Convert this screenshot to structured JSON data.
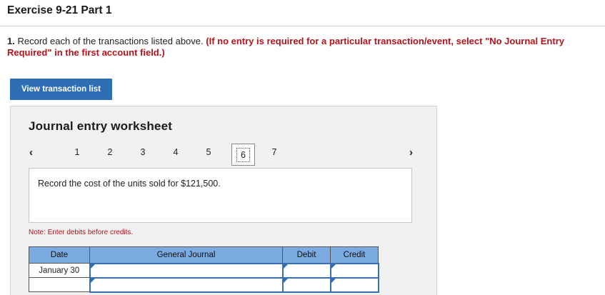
{
  "header": {
    "title": "Exercise 9-21 Part 1"
  },
  "instruction": {
    "number": "1.",
    "text": "Record each of the transactions listed above.",
    "note": "(If no entry is required for a particular transaction/event, select \"No Journal Entry Required\" in the first account field.)"
  },
  "buttons": {
    "view_transaction_list": "View transaction list"
  },
  "worksheet": {
    "title": "Journal entry worksheet",
    "pages": [
      "1",
      "2",
      "3",
      "4",
      "5",
      "6",
      "7"
    ],
    "current_page": "6",
    "prev_icon": "‹",
    "next_icon": "›",
    "description": "Record the cost of the units sold for $121,500.",
    "note": "Note: Enter debits before credits."
  },
  "journal": {
    "headers": {
      "date": "Date",
      "general_journal": "General Journal",
      "debit": "Debit",
      "credit": "Credit"
    },
    "rows": [
      {
        "date": "January 30",
        "account": "",
        "debit": "",
        "credit": ""
      },
      {
        "date": "",
        "account": "",
        "debit": "",
        "credit": ""
      }
    ]
  },
  "colors": {
    "accent": "#2d6eb5",
    "warning_text": "#b4131b",
    "table_header": "#7aaae0"
  }
}
